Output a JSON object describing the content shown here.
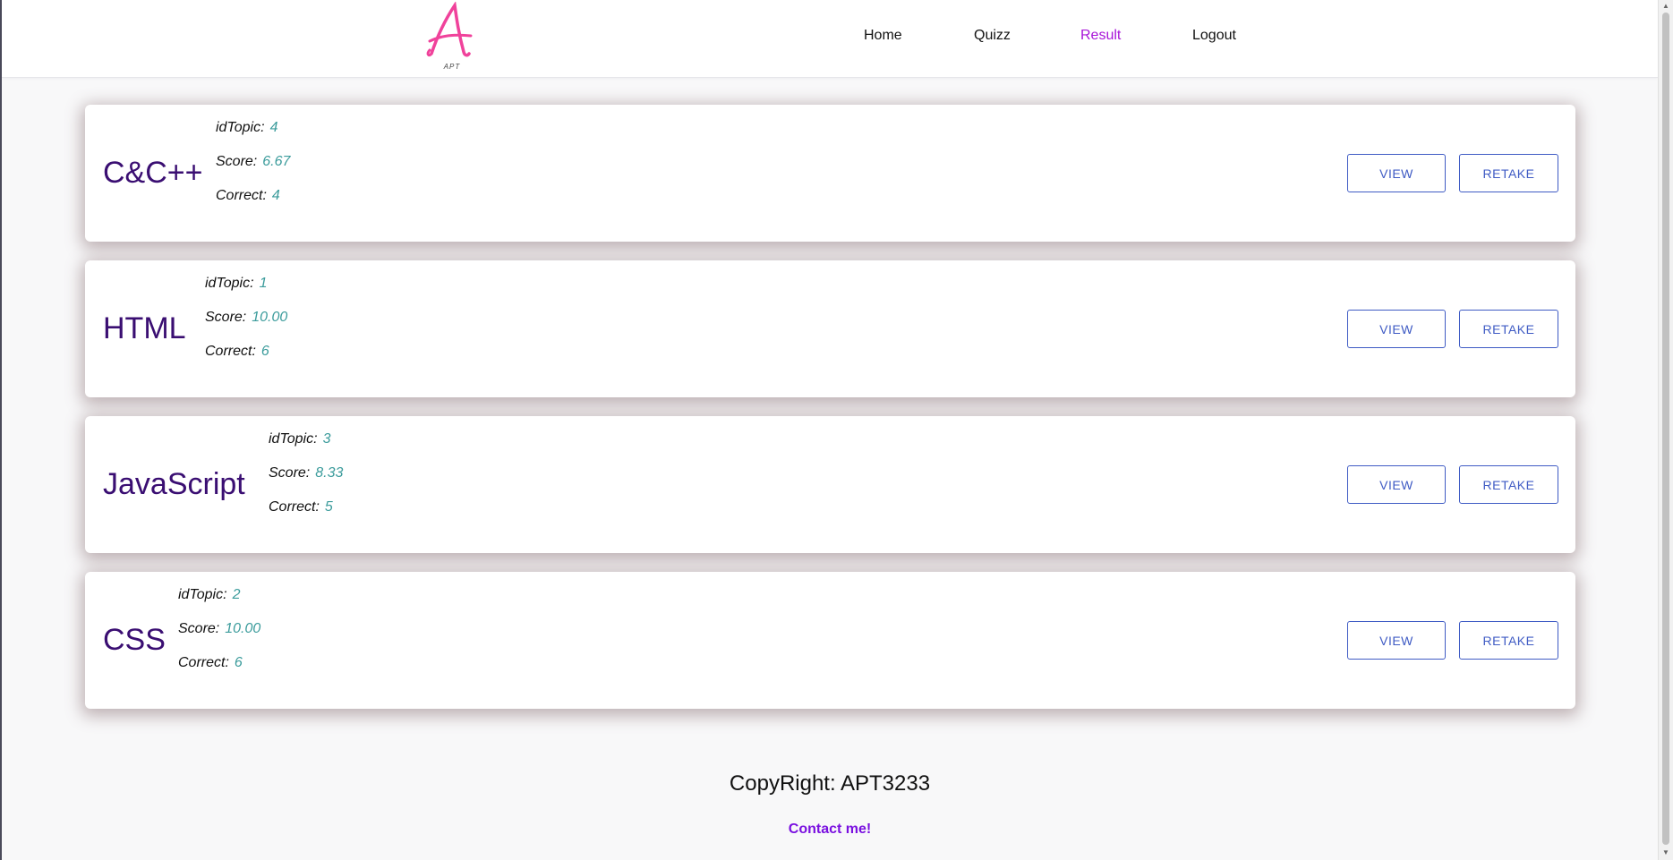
{
  "logo": {
    "letter": "A",
    "caption": "APT",
    "color": "#f0429b"
  },
  "nav": {
    "items": [
      {
        "label": "Home",
        "active": false
      },
      {
        "label": "Quizz",
        "active": false
      },
      {
        "label": "Result",
        "active": true
      },
      {
        "label": "Logout",
        "active": false
      }
    ]
  },
  "labels": {
    "id_topic": "idTopic:",
    "score": "Score:",
    "correct": "Correct:",
    "view": "VIEW",
    "retake": "RETAKE"
  },
  "results": [
    {
      "topic": "C&C++",
      "id_topic": "4",
      "score": "6.67",
      "correct": "4"
    },
    {
      "topic": "HTML",
      "id_topic": "1",
      "score": "10.00",
      "correct": "6"
    },
    {
      "topic": "JavaScript",
      "id_topic": "3",
      "score": "8.33",
      "correct": "5"
    },
    {
      "topic": "CSS",
      "id_topic": "2",
      "score": "10.00",
      "correct": "6"
    }
  ],
  "footer": {
    "title": "CopyRight: APT3233",
    "contact": "Contact me!"
  },
  "colors": {
    "accent": "#a815d8",
    "topic_title": "#3a0e72",
    "value": "#3c9c9c",
    "button": "#3f5bc4",
    "contact_link": "#7a10e0"
  }
}
